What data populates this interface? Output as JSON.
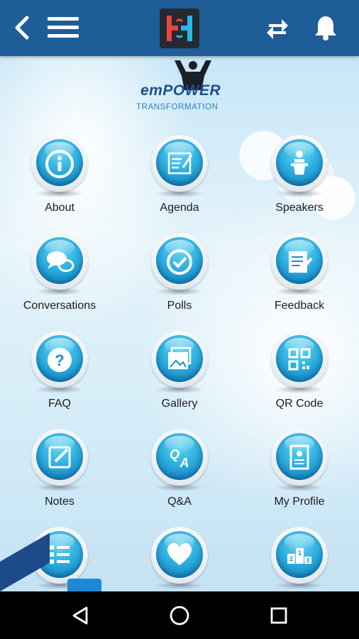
{
  "app": {
    "brand_top": "emPOWER",
    "brand_bottom": "TRANSFORMATION"
  },
  "toolbar": {
    "icons": [
      "back-arrow-icon",
      "hamburger-menu-icon",
      "app-logo-h",
      "sync-icon",
      "notification-bell-icon"
    ]
  },
  "grid": [
    {
      "label": "About",
      "icon": "info-icon"
    },
    {
      "label": "Agenda",
      "icon": "agenda-icon"
    },
    {
      "label": "Speakers",
      "icon": "speaker-podium-icon"
    },
    {
      "label": "Conversations",
      "icon": "chat-bubbles-icon"
    },
    {
      "label": "Polls",
      "icon": "check-circle-icon"
    },
    {
      "label": "Feedback",
      "icon": "feedback-notepad-icon"
    },
    {
      "label": "FAQ",
      "icon": "question-icon"
    },
    {
      "label": "Gallery",
      "icon": "photos-icon"
    },
    {
      "label": "QR Code",
      "icon": "qr-code-icon"
    },
    {
      "label": "Notes",
      "icon": "notes-pencil-icon"
    },
    {
      "label": "Q&A",
      "icon": "qa-icon"
    },
    {
      "label": "My Profile",
      "icon": "profile-card-icon"
    },
    {
      "label": "",
      "icon": "checklist-icon"
    },
    {
      "label": "",
      "icon": "heart-icon"
    },
    {
      "label": "",
      "icon": "leaderboard-podium-icon"
    }
  ],
  "colors": {
    "appbar": "#1f5d98",
    "orb": "#2fb0e0",
    "navbar": "#000000"
  },
  "system_nav": [
    "back-triangle-icon",
    "home-circle-icon",
    "recents-square-icon"
  ]
}
